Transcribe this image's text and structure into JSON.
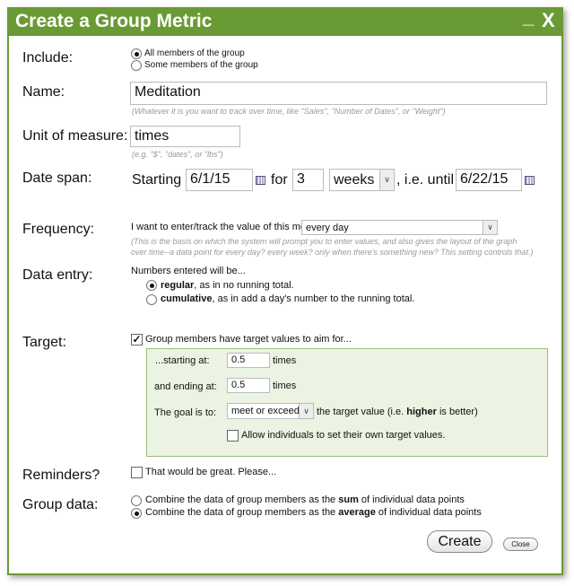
{
  "title": "Create a Group Metric",
  "controls": {
    "minimize": "_",
    "close": "X"
  },
  "include": {
    "label": "Include:",
    "options": [
      "All members of the group",
      "Some members of the group"
    ],
    "selected": 0
  },
  "name": {
    "label": "Name:",
    "value": "Meditation",
    "hint": "(Whatever it is you want to track over time, like \"Sales\", \"Number of Dates\", or \"Weight\")"
  },
  "unit": {
    "label": "Unit of measure:",
    "value": "times",
    "hint": "(e.g. \"$\", \"dates\", or \"lbs\")"
  },
  "date_span": {
    "label": "Date span:",
    "starting": "Starting",
    "start_value": "6/1/15",
    "for": "for",
    "count": "3",
    "period": "weeks",
    "until": ", i.e. until",
    "end_value": "6/22/15"
  },
  "frequency": {
    "label": "Frequency:",
    "prompt": "I want to enter/track the value of this metric",
    "value": "every day",
    "hint1": "(This is the basis on which the system will prompt you to enter values, and also gives the layout of the graph",
    "hint2": "over time--a data point for every day? every week? only when there's something new? This setting controls that.)"
  },
  "data_entry": {
    "label": "Data entry:",
    "intro": "Numbers entered will be...",
    "opt1_bold": "regular",
    "opt1_rest": ", as in no running total.",
    "opt2_bold": "cumulative",
    "opt2_rest": ", as in add a day's number to the running total.",
    "selected": 0
  },
  "target": {
    "label": "Target:",
    "checkbox": "Group members have target values to aim for...",
    "checked": true,
    "start_label": "...starting at:",
    "start_value": "0.5",
    "end_label": "and ending at:",
    "end_value": "0.5",
    "unit": "times",
    "goal_label": "The goal is to:",
    "goal_value": "meet or exceed",
    "goal_pre": "the target value (i.e. ",
    "goal_bold": "higher",
    "goal_post": " is better)",
    "allow": "Allow individuals to set their own target values."
  },
  "reminders": {
    "label": "Reminders?",
    "checkbox": "That would be great. Please..."
  },
  "group_data": {
    "label": "Group data:",
    "pre": "Combine the data of group members as the ",
    "sum": "sum",
    "avg": "average",
    "post": " of individual data points",
    "selected": 1
  },
  "buttons": {
    "create": "Create",
    "close": "Close"
  }
}
